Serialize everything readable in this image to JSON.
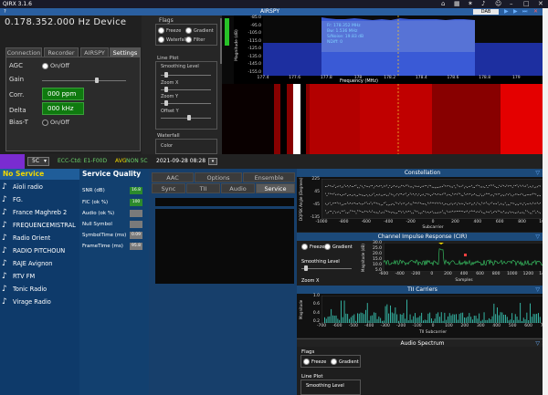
{
  "window": {
    "title": "QIRX 3.1.6",
    "icons": [
      "home-icon",
      "grid-icon",
      "bluetooth-icon",
      "microphone-icon",
      "person-icon",
      "minimize-icon",
      "maximize-icon",
      "close-icon"
    ]
  },
  "topbar": {
    "left_text": "?",
    "center_text": "AIRSPY",
    "selection": "DAB"
  },
  "device": {
    "frequency": "0.178.352.000 Hz Device"
  },
  "tabs": [
    {
      "label": "Connection"
    },
    {
      "label": "Recorder"
    },
    {
      "label": "AIRSPY"
    },
    {
      "label": "Settings"
    }
  ],
  "settings": {
    "agc_label": "AGC",
    "agc_option": "On/Off",
    "gain_label": "Gain",
    "corr_label": "Corr.",
    "corr_value": "000 ppm",
    "delta_label": "Delta",
    "delta_value": "000 kHz",
    "biast_label": "Bias-T",
    "biast_option": "On/Off"
  },
  "flags_panel": {
    "title": "Flags",
    "flags": [
      {
        "label": "Freeze"
      },
      {
        "label": "Gradient"
      },
      {
        "label": "Waterfall"
      },
      {
        "label": "Filter"
      }
    ],
    "lineplot_title": "Line Plot",
    "smoothing_label": "Smoothing Level",
    "zoomx_label": "Zoom X",
    "zoomy_label": "Zoom Y",
    "offsety_label": "Offset Y",
    "waterfall_title": "Waterfall",
    "color_label": "Color"
  },
  "spectrum": {
    "ylabel": "Magnitude (dB)",
    "xlabel": "Frequency (MHz)",
    "y_ticks": [
      "-85.0",
      "-95.0",
      "-105.0",
      "-115.0",
      "-125.0",
      "-135.0",
      "-145.0",
      "-155.0"
    ],
    "x_ticks": [
      "177.4",
      "177.6",
      "177.8",
      "178",
      "178.2",
      "178.4",
      "178.6",
      "178.8",
      "179",
      "179.2"
    ],
    "info": [
      "Fr: 178.352 MHz",
      "Bw: 1.536 MHz",
      "S/Noise: 19.83 dB",
      "NDiff: 0"
    ]
  },
  "statusbar": {
    "channel": "5C",
    "ecc_label": "ECC-Ctd: E1-F00D",
    "avg_label": "AVG",
    "non_label": "NON 5C",
    "datetime": "2021-09-28  08:28"
  },
  "services": {
    "header": "No Service Selected",
    "items": [
      "Aïoli radio",
      "FG.",
      "France Maghreb 2",
      "FREQUENCEMISTRAL",
      "Radio Orient",
      "RADIO PITCHOUN",
      "RAJE Avignon",
      "RTV FM",
      "Tonic Radio",
      "Virage Radio"
    ]
  },
  "quality": {
    "header": "Service Quality",
    "rows": [
      {
        "label": "SNR (dB)",
        "value": "16.8"
      },
      {
        "label": "FIC (ok %)",
        "value": "100"
      },
      {
        "label": "Audio (ok %)",
        "value": ""
      },
      {
        "label": "Null Symbol",
        "value": ""
      },
      {
        "label": "SymbolTime (ms)",
        "value": "0.09"
      },
      {
        "label": "FrameTime (ms)",
        "value": "95.8"
      }
    ]
  },
  "aac_tabs": {
    "row1": [
      "AAC",
      "Options",
      "Ensemble"
    ],
    "row2": [
      "Sync",
      "TII",
      "Audio",
      "Service"
    ]
  },
  "constellation": {
    "title": "Constellation",
    "ylabel": "DQPSK Angle (Degrees)",
    "xlabel": "Subcarrier",
    "y_ticks": [
      "225",
      "45",
      "-45",
      "-135"
    ],
    "x_ticks": [
      "-1000",
      "-800",
      "-600",
      "-400",
      "-200",
      "0",
      "200",
      "400",
      "600",
      "800",
      "1000"
    ]
  },
  "cir": {
    "title": "Channel Impulse Response (CIR)",
    "freeze_label": "Freeze",
    "gradient_label": "Gradient",
    "smoothing_label": "Smoothing Level",
    "zoom_label": "Zoom X",
    "ylabel": "Magnitude (dB)",
    "xlabel": "Samples",
    "y_ticks": [
      "30.0",
      "25.0",
      "20.0",
      "15.0",
      "10.0",
      "5.0"
    ],
    "x_ticks": [
      "-600",
      "-400",
      "-200",
      "0",
      "200",
      "400",
      "600",
      "800",
      "1000",
      "1200",
      "1400"
    ]
  },
  "tii": {
    "title": "TII Carriers",
    "ylabel": "Magnitude",
    "xlabel": "TII Subcarrier",
    "y_ticks": [
      "1.0",
      "0.6",
      "0.4",
      "0.2"
    ],
    "x_ticks": [
      "-700",
      "-600",
      "-500",
      "-400",
      "-300",
      "-200",
      "-100",
      "0",
      "100",
      "200",
      "300",
      "400",
      "500",
      "600",
      "700"
    ]
  },
  "audio_spectrum": {
    "title": "Audio Spectrum",
    "flags_title": "Flags",
    "freeze_label": "Freeze",
    "gradient_label": "Gradient",
    "lineplot_title": "Line Plot",
    "smoothing_label": "Smoothing Level"
  },
  "colors": {
    "accent": "#2a5fa0",
    "green": "#0f7a0f",
    "service_bg": "#0e3a6a",
    "header_yellow": "#f0d800",
    "ensemble_green": "#6bd36b",
    "spectrum_blue": "#1f3fa8",
    "waterfall_red": "#b00000"
  }
}
